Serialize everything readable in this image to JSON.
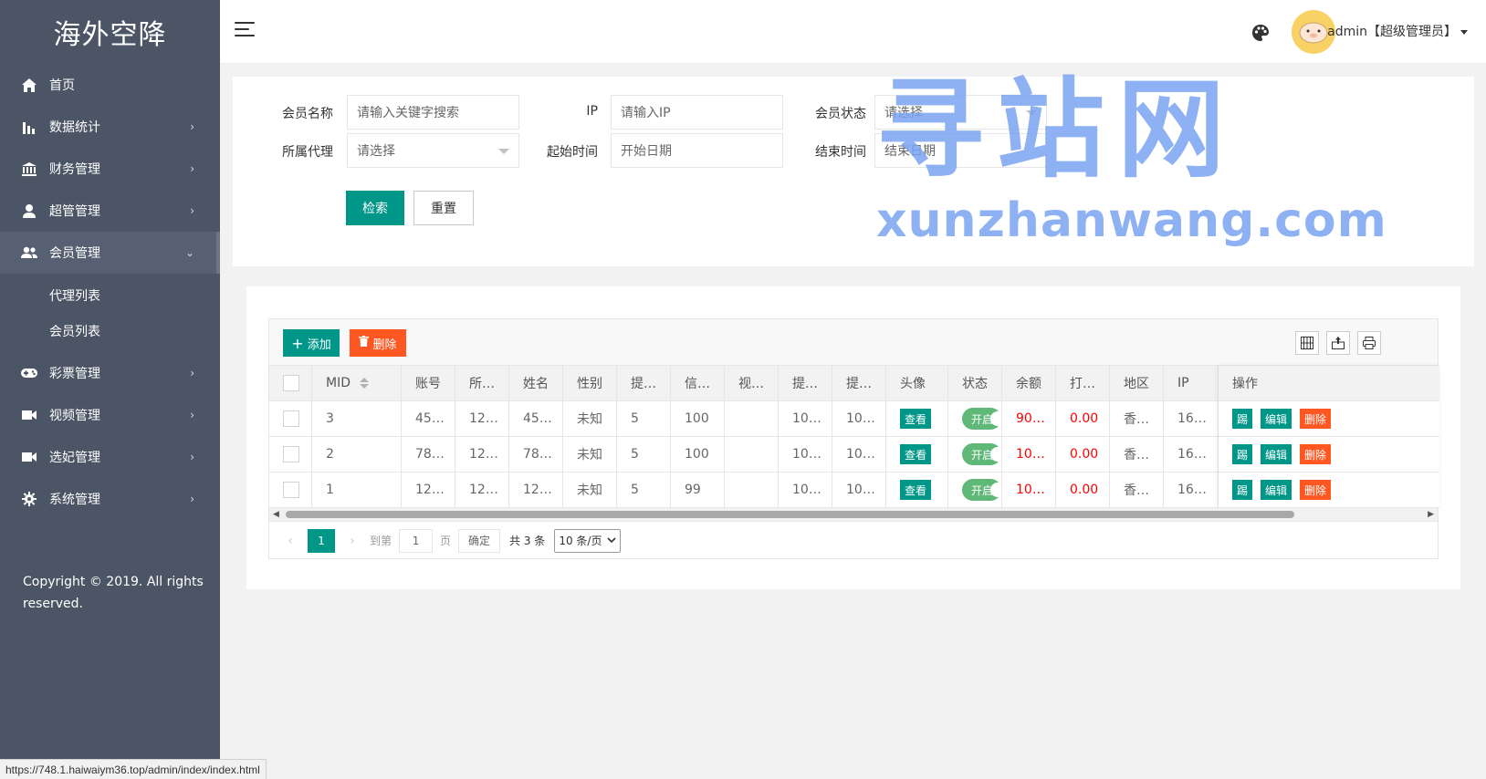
{
  "sidebar": {
    "logo": "海外空降",
    "items": [
      {
        "label": "首页",
        "icon": "home-icon"
      },
      {
        "label": "数据统计",
        "icon": "chart-icon"
      },
      {
        "label": "财务管理",
        "icon": "bank-icon"
      },
      {
        "label": "超管管理",
        "icon": "user-icon"
      },
      {
        "label": "会员管理",
        "icon": "users-icon"
      },
      {
        "label": "彩票管理",
        "icon": "gamepad-icon"
      },
      {
        "label": "视频管理",
        "icon": "video-icon"
      },
      {
        "label": "选妃管理",
        "icon": "video-icon"
      },
      {
        "label": "系统管理",
        "icon": "gear-icon"
      }
    ],
    "sub_items": [
      "代理列表",
      "会员列表"
    ],
    "copyright": "Copyright © 2019. All rights reserved."
  },
  "header": {
    "user": "admin【超级管理员】"
  },
  "search": {
    "member_name_label": "会员名称",
    "member_name_placeholder": "请输入关键字搜索",
    "ip_label": "IP",
    "ip_placeholder": "请输入IP",
    "status_label": "会员状态",
    "status_placeholder": "请选择",
    "agent_label": "所属代理",
    "agent_placeholder": "请选择",
    "start_label": "起始时间",
    "start_placeholder": "开始日期",
    "end_label": "结束时间",
    "end_placeholder": "结束日期",
    "search_button": "检索",
    "reset_button": "重置"
  },
  "watermark": {
    "big": "寻站网",
    "small": "xunzhanwang.com"
  },
  "table": {
    "add_button": "添加",
    "delete_button": "删除",
    "columns": [
      "MID",
      "账号",
      "所…",
      "姓名",
      "性别",
      "提…",
      "信…",
      "视…",
      "提…",
      "提…",
      "头像",
      "状态",
      "余额",
      "打…",
      "地区",
      "IP",
      "操作"
    ],
    "rows": [
      {
        "mid": "3",
        "account": "45…",
        "agent": "12…",
        "name": "45…",
        "gender": "未知",
        "c5": "5",
        "credit": "100",
        "video": "",
        "c8": "10…",
        "c9": "10…",
        "avatar_btn": "查看",
        "status": "开启",
        "balance": "90…",
        "bet": "0.00",
        "region": "香…",
        "ip": "16…"
      },
      {
        "mid": "2",
        "account": "78…",
        "agent": "12…",
        "name": "78…",
        "gender": "未知",
        "c5": "5",
        "credit": "100",
        "video": "",
        "c8": "10…",
        "c9": "10…",
        "avatar_btn": "查看",
        "status": "开启",
        "balance": "10…",
        "bet": "0.00",
        "region": "香…",
        "ip": "16…"
      },
      {
        "mid": "1",
        "account": "12…",
        "agent": "12…",
        "name": "12…",
        "gender": "未知",
        "c5": "5",
        "credit": "99",
        "video": "",
        "c8": "10…",
        "c9": "10…",
        "avatar_btn": "查看",
        "status": "开启",
        "balance": "10…",
        "bet": "0.00",
        "region": "香…",
        "ip": "16…"
      }
    ],
    "actions": [
      "踢",
      "编辑",
      "删除"
    ]
  },
  "pager": {
    "current": "1",
    "goto_label": "到第",
    "goto_value": "1",
    "page_label": "页",
    "confirm": "确定",
    "total": "共 3 条",
    "page_size": "10 条/页"
  },
  "statusbar": {
    "url": "https://748.1.haiwaiym36.top/admin/index/index.html"
  },
  "colors": {
    "sidebar_bg": "#4b5565",
    "primary": "#009688",
    "danger": "#ff5722",
    "switch_on": "#5fb878",
    "watermark": "#7ba4f2"
  }
}
